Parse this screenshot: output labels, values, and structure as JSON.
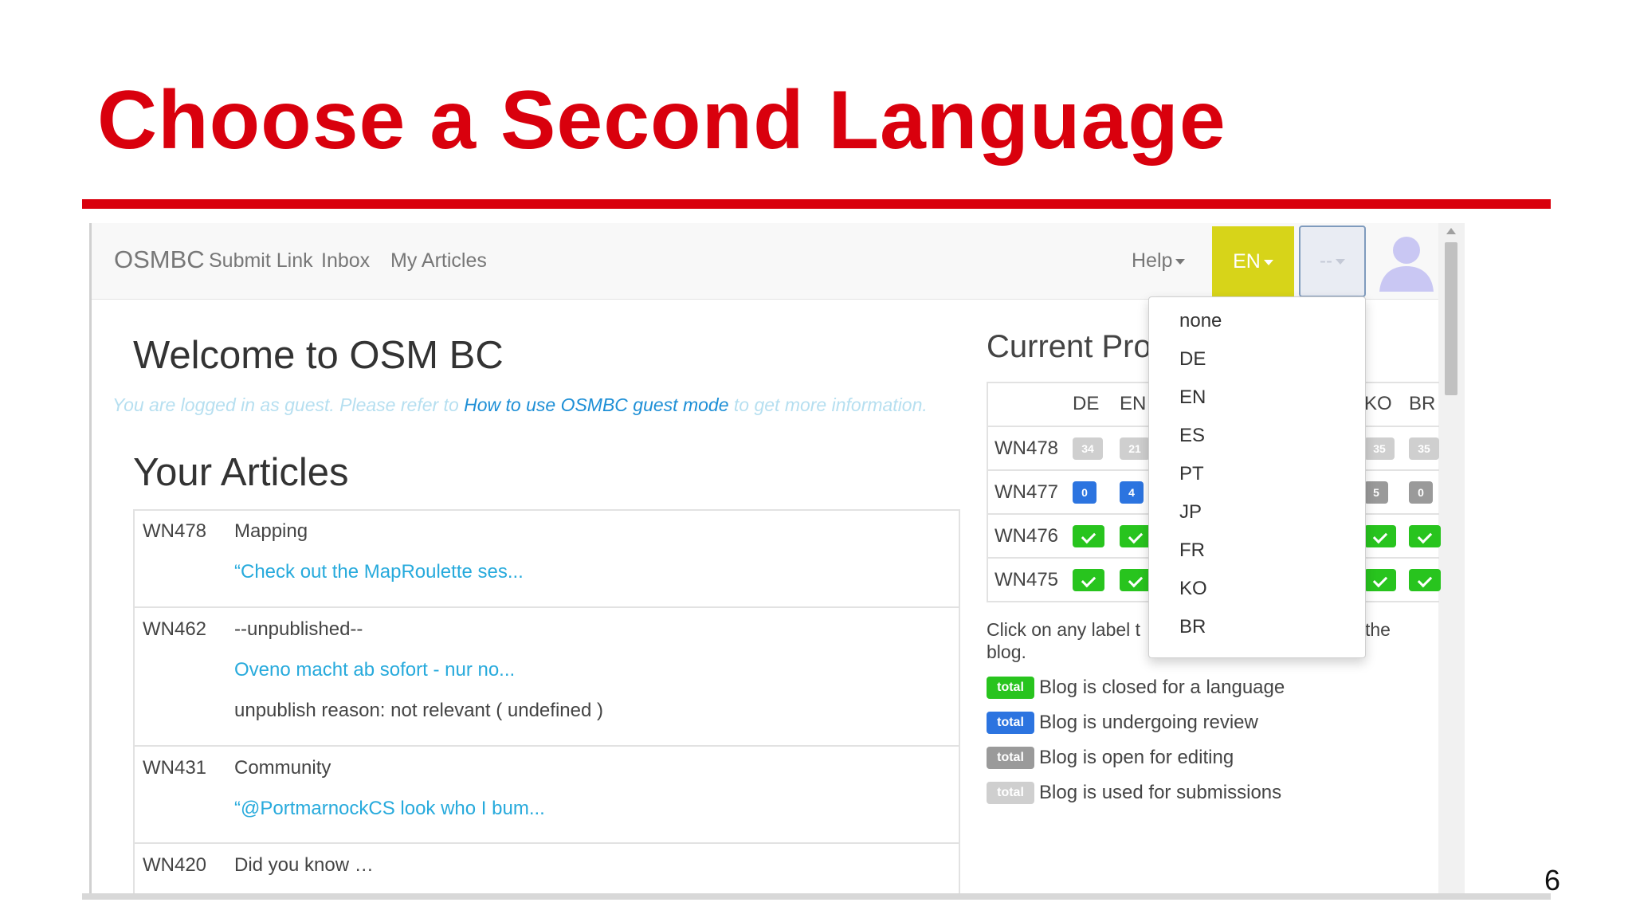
{
  "slide": {
    "title": "Choose a Second Language",
    "page_number": "6"
  },
  "navbar": {
    "brand": "OSMBC",
    "links": [
      "Submit Link",
      "Inbox",
      "My Articles"
    ],
    "help": "Help",
    "language_button": "EN",
    "second_language_button": "--",
    "avatar_icon": "user-avatar-icon"
  },
  "welcome": {
    "title": "Welcome to OSM BC",
    "guest_prefix": "You are logged in as guest. Please refer to ",
    "guest_link": "How to use OSMBC guest mode",
    "guest_suffix": " to get more information."
  },
  "your_articles": {
    "title": "Your Articles",
    "rows": [
      {
        "blog": "WN478",
        "lines": [
          "Mapping",
          "“Check out the MapRoulette ses..."
        ]
      },
      {
        "blog": "WN462",
        "lines": [
          "--unpublished--",
          "Oveno macht ab sofort - nur no...",
          "unpublish reason: not relevant ( undefined )"
        ]
      },
      {
        "blog": "WN431",
        "lines": [
          "Community",
          "“@PortmarnockCS look who I bum..."
        ]
      },
      {
        "blog": "WN420",
        "lines": [
          "Did you know …"
        ]
      }
    ]
  },
  "current_production": {
    "title": "Current Pro",
    "columns": [
      "DE",
      "EN",
      "KO",
      "BR"
    ],
    "rows": [
      {
        "blog": "WN478",
        "de": "34",
        "en": "21",
        "ko": "35",
        "br": "35",
        "status": "open"
      },
      {
        "blog": "WN477",
        "de": "0",
        "en": "4",
        "ko": "5",
        "br": "0",
        "status": "mixed"
      },
      {
        "blog": "WN476",
        "status": "closed"
      },
      {
        "blog": "WN475",
        "status": "closed"
      }
    ],
    "note": "Click on any label t",
    "note_end": "the",
    "note_line2": "blog."
  },
  "legend": [
    {
      "badge": "total",
      "text": "Blog is closed for a language",
      "color": "#28c41e"
    },
    {
      "badge": "total",
      "text": "Blog is undergoing review",
      "color": "#2c74e0"
    },
    {
      "badge": "total",
      "text": "Blog is open for editing",
      "color": "#9a9a9a"
    },
    {
      "badge": "total",
      "text": "Blog is used for submissions",
      "color": "#cfcfcf"
    }
  ],
  "dropdown": {
    "options": [
      "none",
      "DE",
      "EN",
      "ES",
      "PT",
      "JP",
      "FR",
      "KO",
      "BR"
    ]
  },
  "colors": {
    "title_red": "#d9000d",
    "language_button": "#d7d419",
    "link_blue": "#1e8fd6"
  }
}
